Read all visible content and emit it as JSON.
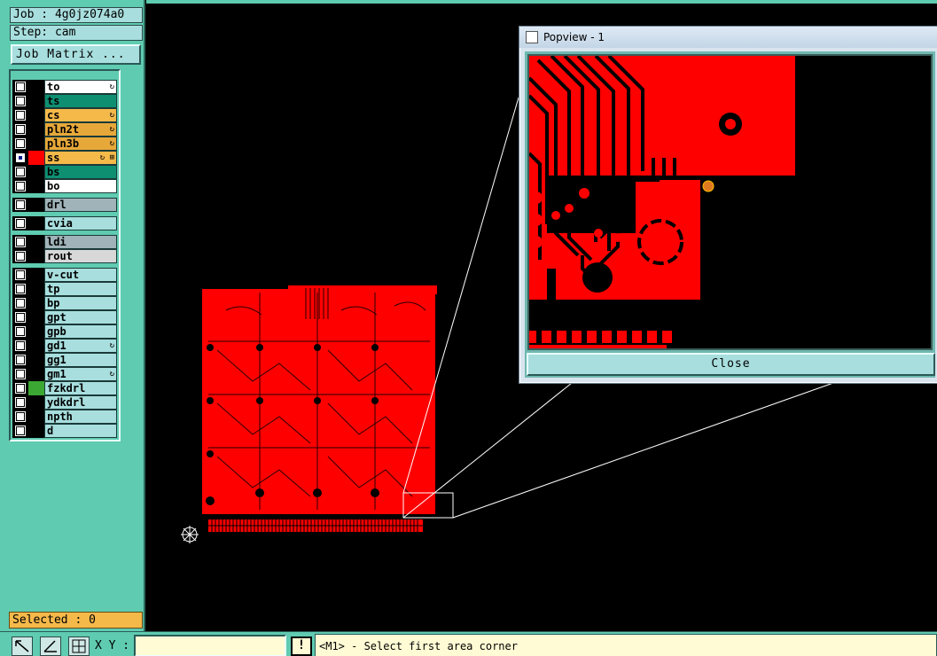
{
  "job_label": "Job : 4g0jz074a0",
  "step_label": "Step: cam",
  "job_matrix_button": "Job Matrix ...",
  "layers": [
    {
      "name": "to",
      "bg": "#ffffff",
      "color": "#000000",
      "checked": false,
      "flag": "↻"
    },
    {
      "name": "ts",
      "bg": "#0e8f72",
      "color": "#000000",
      "checked": false,
      "flag": ""
    },
    {
      "name": "cs",
      "bg": "#f5b94a",
      "color": "#000000",
      "checked": false,
      "flag": "↻"
    },
    {
      "name": "pln2t",
      "bg": "#e7a83a",
      "color": "#000000",
      "checked": false,
      "flag": "↻"
    },
    {
      "name": "pln3b",
      "bg": "#e7a83a",
      "color": "#000000",
      "checked": false,
      "flag": "↻"
    },
    {
      "name": "ss",
      "bg": "#f5b94a",
      "color": "#ff0000",
      "checked": true,
      "flag": "↻ ⊞"
    },
    {
      "name": "bs",
      "bg": "#0e8f72",
      "color": "#000000",
      "checked": false,
      "flag": ""
    },
    {
      "name": "bo",
      "bg": "#ffffff",
      "color": "#000000",
      "checked": false,
      "flag": ""
    },
    {
      "name": "drl",
      "bg": "#9fb3b8",
      "color": "#000000",
      "checked": false,
      "flag": ""
    },
    {
      "name": "cvia",
      "bg": "#a8dede",
      "color": "#000000",
      "checked": false,
      "flag": ""
    },
    {
      "name": "ldi",
      "bg": "#9fb3b8",
      "color": "#000000",
      "checked": false,
      "flag": ""
    },
    {
      "name": "rout",
      "bg": "#d8d8d8",
      "color": "#000000",
      "checked": false,
      "flag": ""
    },
    {
      "name": "v-cut",
      "bg": "#a8dede",
      "color": "#000000",
      "checked": false,
      "flag": ""
    },
    {
      "name": "tp",
      "bg": "#a8dede",
      "color": "#000000",
      "checked": false,
      "flag": ""
    },
    {
      "name": "bp",
      "bg": "#a8dede",
      "color": "#000000",
      "checked": false,
      "flag": ""
    },
    {
      "name": "gpt",
      "bg": "#a8dede",
      "color": "#000000",
      "checked": false,
      "flag": ""
    },
    {
      "name": "gpb",
      "bg": "#a8dede",
      "color": "#000000",
      "checked": false,
      "flag": ""
    },
    {
      "name": "gd1",
      "bg": "#a8dede",
      "color": "#000000",
      "checked": false,
      "flag": "↻"
    },
    {
      "name": "gg1",
      "bg": "#a8dede",
      "color": "#000000",
      "checked": false,
      "flag": ""
    },
    {
      "name": "gm1",
      "bg": "#a8dede",
      "color": "#000000",
      "checked": false,
      "flag": "↻"
    },
    {
      "name": "fzkdrl",
      "bg": "#a8dede",
      "color": "#3aa832",
      "checked": false,
      "flag": ""
    },
    {
      "name": "ydkdrl",
      "bg": "#a8dede",
      "color": "#000000",
      "checked": false,
      "flag": ""
    },
    {
      "name": "npth",
      "bg": "#a8dede",
      "color": "#000000",
      "checked": false,
      "flag": ""
    },
    {
      "name": "d",
      "bg": "#a8dede",
      "color": "#000000",
      "checked": false,
      "flag": ""
    }
  ],
  "selected_label": "Selected : 0",
  "popview": {
    "title": "Popview - 1",
    "close_label": "Close"
  },
  "bottom": {
    "xy_label": "X Y :",
    "xy_value": "",
    "bang": "!",
    "status": "<M1> - Select first area corner"
  },
  "colors": {
    "panel": "#5fcbb0",
    "copper": "#ff0000",
    "canvas": "#000000"
  }
}
